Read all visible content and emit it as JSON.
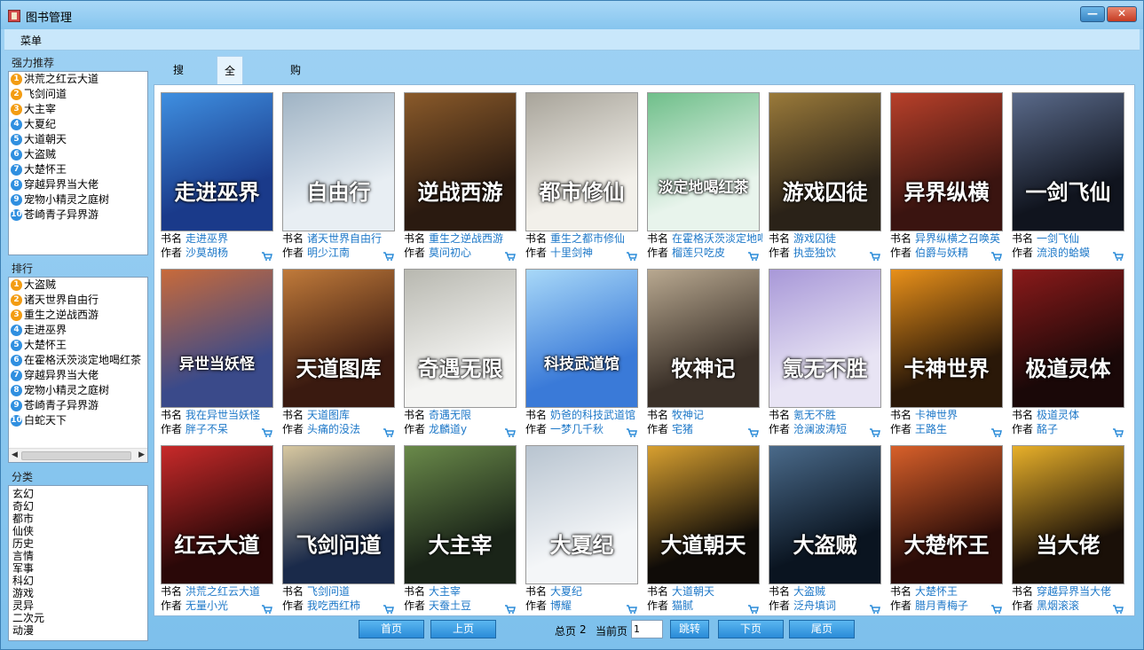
{
  "window": {
    "title": "图书管理",
    "min_label": "—",
    "close_label": "✕"
  },
  "menu": {
    "label": "菜单"
  },
  "recommend": {
    "label": "强力推荐",
    "items": [
      "洪荒之红云大道",
      "飞剑问道",
      "大主宰",
      "大夏纪",
      "大道朝天",
      "大盗贼",
      "大楚怀王",
      "穿越异界当大佬",
      "宠物小精灵之庭树",
      "苍崎青子异界游"
    ]
  },
  "ranking": {
    "label": "排行",
    "items": [
      "大盗贼",
      "诸天世界自由行",
      "重生之逆战西游",
      "走进巫界",
      "大楚怀王",
      "在霍格沃茨淡定地喝红茶",
      "穿越异界当大佬",
      "宠物小精灵之庭树",
      "苍崎青子异界游",
      "白蛇天下"
    ]
  },
  "category": {
    "label": "分类",
    "items": [
      "玄幻",
      "奇幻",
      "都市",
      "仙侠",
      "历史",
      "言情",
      "军事",
      "科幻",
      "游戏",
      "灵异",
      "二次元",
      "动漫"
    ]
  },
  "tabs": [
    {
      "label": "搜索",
      "active": false
    },
    {
      "label": "全部作品",
      "active": true
    },
    {
      "label": "购物车",
      "active": false
    }
  ],
  "labels": {
    "name": "书名",
    "author": "作者"
  },
  "books": [
    {
      "name": "走进巫界",
      "author": "沙莫胡杨",
      "cover_text": "走进巫界",
      "c1": "#1a3a8a",
      "c2": "#3f8fe0"
    },
    {
      "name": "诸天世界自由行",
      "author": "明少江南",
      "cover_text": "自由行",
      "c1": "#e8eef3",
      "c2": "#9fb3c4"
    },
    {
      "name": "重生之逆战西游",
      "author": "莫问初心",
      "cover_text": "逆战西游",
      "c1": "#2a1a10",
      "c2": "#8a5a2a"
    },
    {
      "name": "重生之都市修仙",
      "author": "十里剑神",
      "cover_text": "都市修仙",
      "c1": "#f2f0ea",
      "c2": "#a8a49a"
    },
    {
      "name": "在霍格沃茨淡定地喝红茶",
      "author": "榴莲只吃皮",
      "cover_text": "淡定地喝红茶",
      "c1": "#e8f4ec",
      "c2": "#6fbf8a"
    },
    {
      "name": "游戏囚徒",
      "author": "执壶独饮",
      "cover_text": "游戏囚徒",
      "c1": "#2a2218",
      "c2": "#9a7a3a"
    },
    {
      "name": "异界纵横之召唤英",
      "author": "伯爵与妖精",
      "cover_text": "异界纵横",
      "c1": "#3a1410",
      "c2": "#b8402a"
    },
    {
      "name": "一剑飞仙",
      "author": "流浪的蛤蟆",
      "cover_text": "一剑飞仙",
      "c1": "#10141e",
      "c2": "#5a6a8a"
    },
    {
      "name": "我在异世当妖怪",
      "author": "胖子不呆",
      "cover_text": "异世当妖怪",
      "c1": "#3a4a8a",
      "c2": "#c86a3a"
    },
    {
      "name": "天道图库",
      "author": "头痛的没法",
      "cover_text": "天道图库",
      "c1": "#3a1a10",
      "c2": "#c07a3a"
    },
    {
      "name": "奇遇无限",
      "author": "龙麟道y",
      "cover_text": "奇遇无限",
      "c1": "#f4f4f2",
      "c2": "#b8b8b0"
    },
    {
      "name": "奶爸的科技武道馆",
      "author": "一梦几千秋",
      "cover_text": "科技武道馆",
      "c1": "#3a7ad8",
      "c2": "#a8d8f8"
    },
    {
      "name": "牧神记",
      "author": "宅猪",
      "cover_text": "牧神记",
      "c1": "#3a3028",
      "c2": "#b8a890"
    },
    {
      "name": "氪无不胜",
      "author": "沧澜波涛短",
      "cover_text": "氪无不胜",
      "c1": "#e8e4f4",
      "c2": "#a898d8"
    },
    {
      "name": "卡神世界",
      "author": "王路生",
      "cover_text": "卡神世界",
      "c1": "#2a1808",
      "c2": "#e8901a"
    },
    {
      "name": "极道灵体",
      "author": "酩子",
      "cover_text": "极道灵体",
      "c1": "#1a0808",
      "c2": "#8a1a1a"
    },
    {
      "name": "洪荒之红云大道",
      "author": "无量小光",
      "cover_text": "红云大道",
      "c1": "#2a0808",
      "c2": "#c82a2a"
    },
    {
      "name": "飞剑问道",
      "author": "我吃西红柿",
      "cover_text": "飞剑问道",
      "c1": "#1a2a4a",
      "c2": "#d8c8a0"
    },
    {
      "name": "大主宰",
      "author": "天蚕土豆",
      "cover_text": "大主宰",
      "c1": "#1a2418",
      "c2": "#6a8a4a"
    },
    {
      "name": "大夏纪",
      "author": "博耀",
      "cover_text": "大夏纪",
      "c1": "#f4f6f8",
      "c2": "#b8c4d0"
    },
    {
      "name": "大道朝天",
      "author": "猫腻",
      "cover_text": "大道朝天",
      "c1": "#100c08",
      "c2": "#d8a030"
    },
    {
      "name": "大盗贼",
      "author": "泛舟填词",
      "cover_text": "大盗贼",
      "c1": "#0a1420",
      "c2": "#4a6a8a"
    },
    {
      "name": "大楚怀王",
      "author": "腊月青梅子",
      "cover_text": "大楚怀王",
      "c1": "#2a0c08",
      "c2": "#d8602a"
    },
    {
      "name": "穿越异界当大佬",
      "author": "黑烟滚滚",
      "cover_text": "当大佬",
      "c1": "#1a1008",
      "c2": "#e8b02a"
    }
  ],
  "pager": {
    "first": "首页",
    "prev": "上页",
    "total_label": "总页",
    "total": "2",
    "current_label": "当前页",
    "current": "1",
    "jump": "跳转",
    "next": "下页",
    "last": "尾页"
  }
}
